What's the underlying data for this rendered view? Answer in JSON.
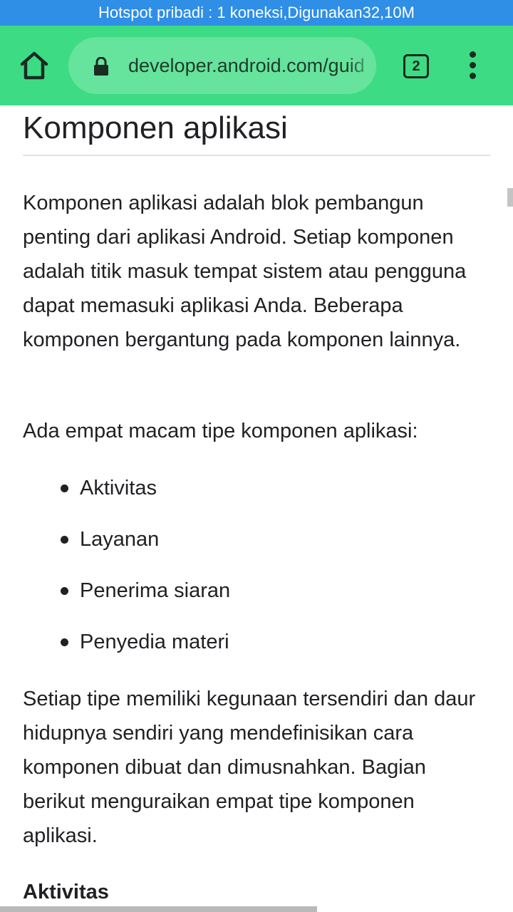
{
  "status_bar": {
    "text": "Hotspot pribadi : 1 koneksi,Digunakan32,10M"
  },
  "colors": {
    "status_bar_bg": "#2f8ee6",
    "toolbar_bg": "#3ddc84",
    "url_bar_bg": "#66e39c",
    "text": "#202124"
  },
  "toolbar": {
    "home_icon": "home-icon",
    "lock_icon": "lock-icon",
    "url": "developer.android.com/guide/components/fundamentals",
    "tab_count": "2",
    "menu_icon": "more-vert-icon"
  },
  "page": {
    "title": "Komponen aplikasi",
    "intro": "Komponen aplikasi adalah blok pembangun penting dari aplikasi Android. Setiap komponen adalah titik masuk tempat sistem atau pengguna dapat memasuki aplikasi Anda. Beberapa komponen bergantung pada komponen lainnya.",
    "types_intro": "Ada empat macam tipe komponen aplikasi:",
    "types": [
      "Aktivitas",
      "Layanan",
      "Penerima siaran",
      "Penyedia materi"
    ],
    "lifecycle": "Setiap tipe memiliki kegunaan tersendiri dan daur hidupnya sendiri yang mendefinisikan cara komponen dibuat dan dimusnahkan. Bagian berikut menguraikan empat tipe komponen aplikasi.",
    "section_heading": "Aktivitas"
  }
}
